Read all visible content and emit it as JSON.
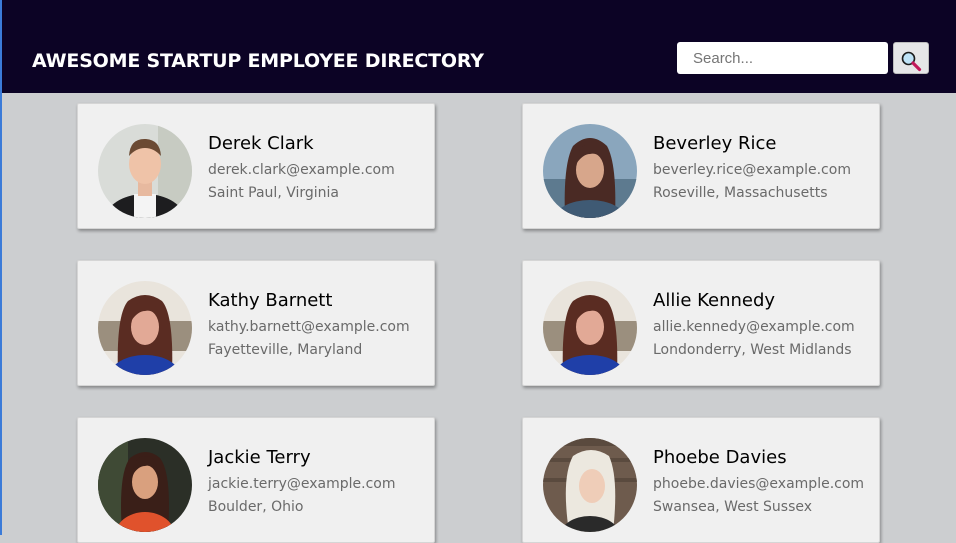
{
  "header": {
    "title": "AWESOME STARTUP EMPLOYEE DIRECTORY",
    "search_placeholder": "Search...",
    "search_icon": "magnifying-glass-icon"
  },
  "employees": [
    {
      "name": "Derek Clark",
      "email": "derek.clark@example.com",
      "location": "Saint Paul, Virginia"
    },
    {
      "name": "Beverley Rice",
      "email": "beverley.rice@example.com",
      "location": "Roseville, Massachusetts"
    },
    {
      "name": "Kathy Barnett",
      "email": "kathy.barnett@example.com",
      "location": "Fayetteville, Maryland"
    },
    {
      "name": "Allie Kennedy",
      "email": "allie.kennedy@example.com",
      "location": "Londonderry, West Midlands"
    },
    {
      "name": "Jackie Terry",
      "email": "jackie.terry@example.com",
      "location": "Boulder, Ohio"
    },
    {
      "name": "Phoebe Davies",
      "email": "phoebe.davies@example.com",
      "location": "Swansea, West Sussex"
    }
  ],
  "colors": {
    "header_bg": "#0c0325",
    "page_bg": "#ccced0",
    "card_bg": "#f0f0f0"
  }
}
